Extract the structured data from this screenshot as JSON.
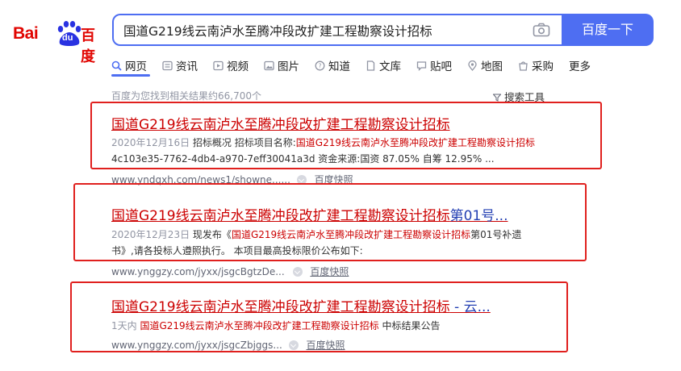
{
  "logo": {
    "latin": "Bai",
    "du": "du",
    "chinese": "百度"
  },
  "search": {
    "query": "国道G219线云南泸水至腾冲段改扩建工程勘察设计招标",
    "button_label": "百度一下"
  },
  "tabs": [
    {
      "label": "网页",
      "icon": "search-icon",
      "active": true
    },
    {
      "label": "资讯",
      "icon": "news-icon"
    },
    {
      "label": "视频",
      "icon": "video-icon"
    },
    {
      "label": "图片",
      "icon": "image-icon"
    },
    {
      "label": "知道",
      "icon": "question-icon"
    },
    {
      "label": "文库",
      "icon": "document-icon"
    },
    {
      "label": "贴吧",
      "icon": "forum-icon"
    },
    {
      "label": "地图",
      "icon": "map-icon"
    },
    {
      "label": "采购",
      "icon": "shopping-icon"
    },
    {
      "label": "更多"
    }
  ],
  "result_count": "百度为您找到相关结果约66,700个",
  "search_tools": "搜索工具",
  "results": [
    {
      "title": "国道G219线云南泸水至腾冲段改扩建工程勘察设计招标",
      "date": "2020年12月16日",
      "snippet_prefix": "招标概况 招标项目名称:",
      "snippet_em": "国道G219线云南泸水至腾冲段改扩建工程勘察设计招标",
      "snippet_line2": "4c103e35-7762-4db4-a970-7eff30041a3d 资金来源:国资 87.05% 自筹 12.95% ...",
      "url": "www.yndqxh.com/news1/showne......",
      "snapshot": "百度快照"
    },
    {
      "title": "国道G219线云南泸水至腾冲段改扩建工程勘察设计招标",
      "title_suffix": "第01号...",
      "date": "2020年12月23日",
      "snippet_prefix": "现发布《",
      "snippet_em": "国道G219线云南泸水至腾冲段改扩建工程勘察设计招标",
      "snippet_suffix": "第01号补遗",
      "snippet_line2": "书》,请各投标人遵照执行。 本项目最高投标限价公布如下:",
      "url": "www.ynggzy.com/jyxx/jsgcBgtzDe...",
      "snapshot": "百度快照"
    },
    {
      "title": "国道G219线云南泸水至腾冲段改扩建工程勘察设计招标",
      "title_suffix": " - 云...",
      "date": "1天内",
      "snippet_em": "国道G219线云南泸水至腾冲段改扩建工程勘察设计招标",
      "snippet_suffix": " 中标结果公告",
      "url": "www.ynggzy.com/jyxx/jsgcZbjggs...",
      "snapshot": "百度快照"
    }
  ]
}
